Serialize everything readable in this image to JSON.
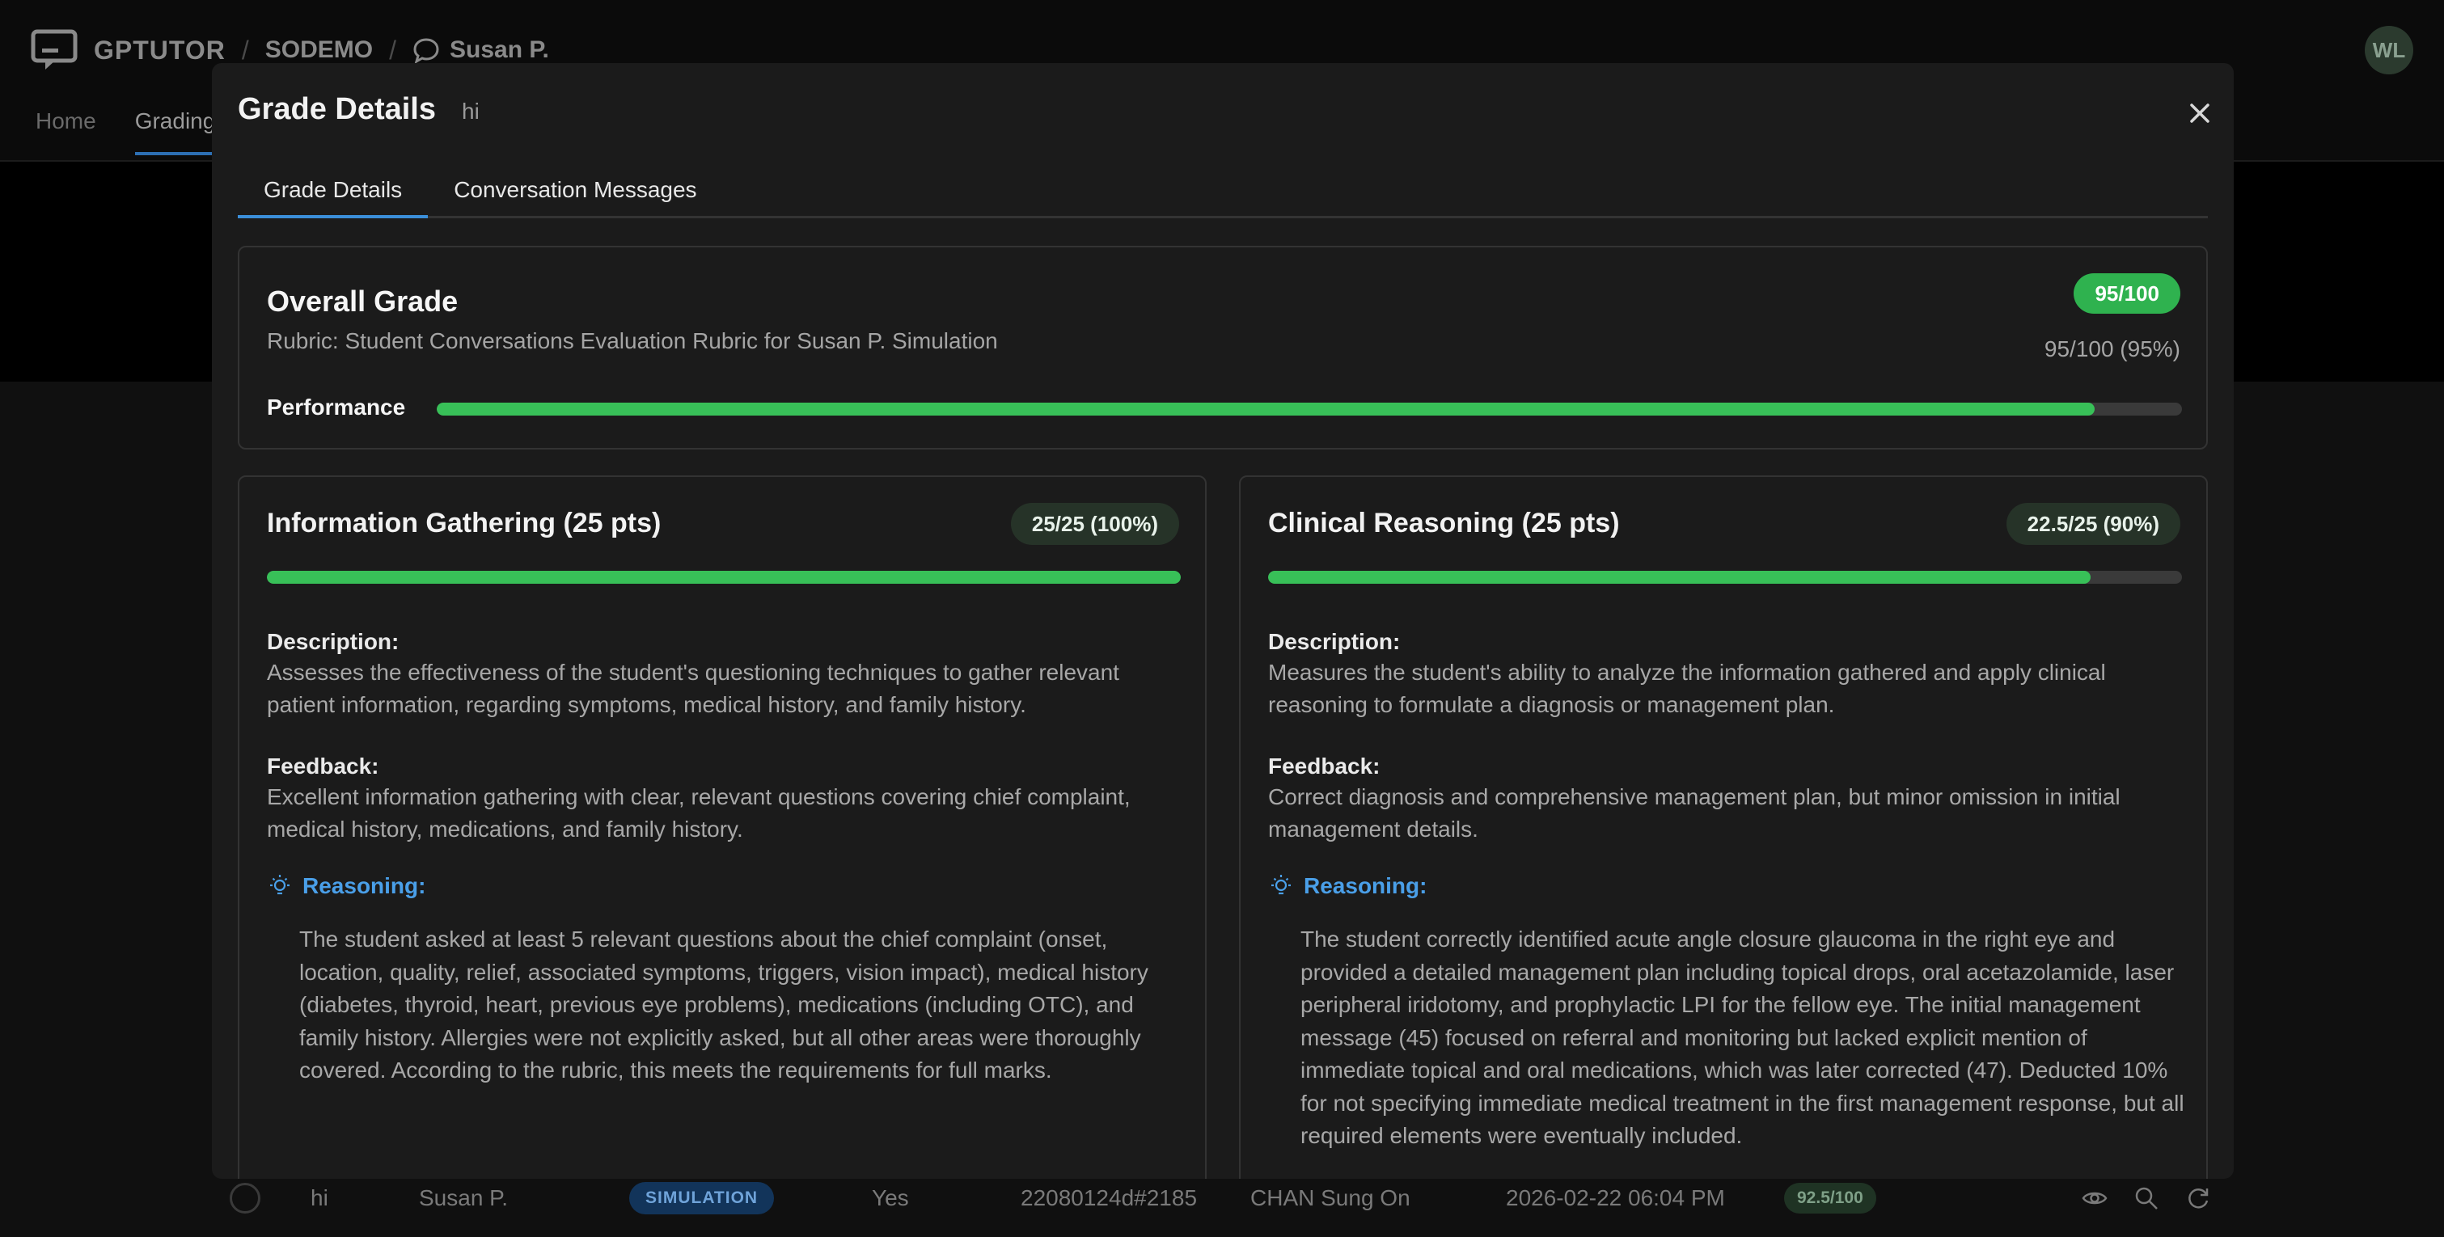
{
  "app": {
    "brand": "GPTUTOR",
    "breadcrumb": [
      "SODEMO",
      "Susan P."
    ],
    "avatar_initials": "WL",
    "nav_tabs": [
      "Home",
      "Grading"
    ]
  },
  "background_row": {
    "title": "hi",
    "patient": "Susan P.",
    "type": "SIMULATION",
    "completed": "Yes",
    "student_id": "22080124d#2185",
    "student_name": "CHAN Sung On",
    "datetime": "2026-02-22 06:04 PM",
    "score": "92.5/100",
    "icons": [
      "eye-icon",
      "search-icon",
      "refresh-icon"
    ]
  },
  "modal": {
    "title": "Grade Details",
    "subtitle": "hi",
    "tabs": [
      "Grade Details",
      "Conversation Messages"
    ],
    "active_tab": 0,
    "overall": {
      "title": "Overall Grade",
      "rubric": "Rubric: Student Conversations Evaluation Rubric for Susan P. Simulation",
      "score_badge": "95/100",
      "score_detail": "95/100 (95%)",
      "performance_label": "Performance",
      "performance_fraction": 0.95
    },
    "criteria": [
      {
        "title": "Information Gathering (25 pts)",
        "score_badge": "25/25 (100%)",
        "fraction": 1.0,
        "description_label": "Description:",
        "description": "Assesses the effectiveness of the student's questioning techniques to gather relevant patient information, regarding symptoms, medical history, and family history.",
        "feedback_label": "Feedback:",
        "feedback": "Excellent information gathering with clear, relevant questions covering chief complaint, medical history, medications, and family history.",
        "reasoning_label": "Reasoning:",
        "reasoning": "The student asked at least 5 relevant questions about the chief complaint (onset, location, quality, relief, associated symptoms, triggers, vision impact), medical history (diabetes, thyroid, heart, previous eye problems), medications (including OTC), and family history. Allergies were not explicitly asked, but all other areas were thoroughly covered. According to the rubric, this meets the requirements for full marks."
      },
      {
        "title": "Clinical Reasoning (25 pts)",
        "score_badge": "22.5/25 (90%)",
        "fraction": 0.9,
        "description_label": "Description:",
        "description": "Measures the student's ability to analyze the information gathered and apply clinical reasoning to formulate a diagnosis or management plan.",
        "feedback_label": "Feedback:",
        "feedback": "Correct diagnosis and comprehensive management plan, but minor omission in initial management details.",
        "reasoning_label": "Reasoning:",
        "reasoning": "The student correctly identified acute angle closure glaucoma in the right eye and provided a detailed management plan including topical drops, oral acetazolamide, laser peripheral iridotomy, and prophylactic LPI for the fellow eye. The initial management message (45) focused on referral and monitoring but lacked explicit mention of immediate topical and oral medications, which was later corrected (47). Deducted 10% for not specifying immediate medical treatment in the first management response, but all required elements were eventually included."
      }
    ]
  },
  "colors": {
    "accent_blue": "#3b8fd9",
    "success_green": "#38c058",
    "reasoning_blue": "#4a9fe8"
  }
}
